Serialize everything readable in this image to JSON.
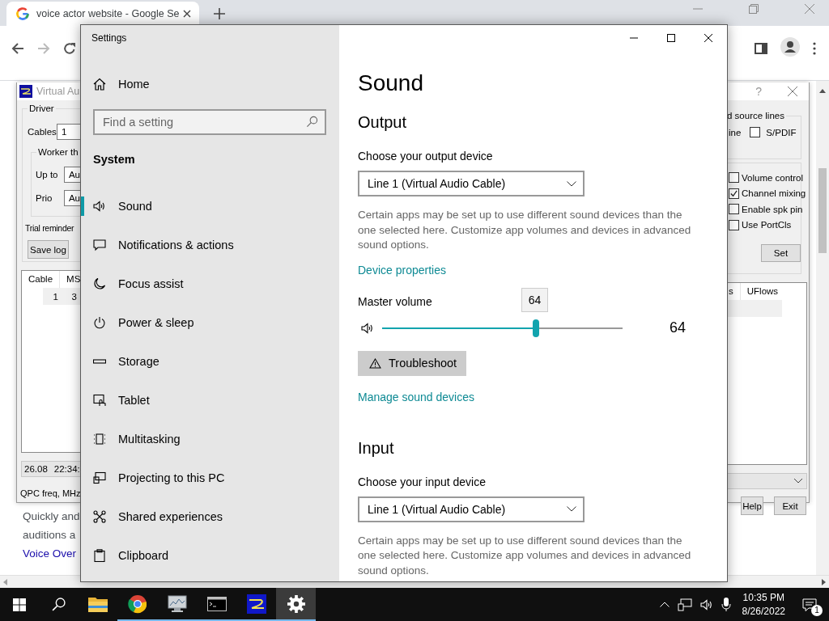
{
  "browser": {
    "tab": {
      "title": "voice actor website - Google Se",
      "selected": true
    },
    "page_lines": [
      {
        "kind": "text",
        "text": "Quickly and"
      },
      {
        "kind": "text",
        "text": "auditions a"
      },
      {
        "kind": "link",
        "text": "Voice Over"
      }
    ]
  },
  "vac": {
    "title": "Virtual Au",
    "driver": {
      "label": "Driver",
      "cables_label": "Cables",
      "cables_value": "1"
    },
    "worker": {
      "label": "Worker th",
      "fields": [
        {
          "label": "Up to",
          "value": "Au"
        },
        {
          "label": "Prio",
          "value": "Au"
        }
      ]
    },
    "trial": "Trial reminder",
    "save_log": "Save log",
    "left_columns": [
      "Cable",
      "MS"
    ],
    "left_row": [
      "1",
      "3"
    ],
    "status": [
      "26.08",
      "22:34:"
    ],
    "qpc": "QPC freq, MHz",
    "help": "?",
    "source_group": "d source lines",
    "source_fragment": "ine",
    "spdif": {
      "label": "S/PDIF",
      "checked": false
    },
    "options": [
      {
        "label": "Volume control",
        "checked": false
      },
      {
        "label": "Channel mixing",
        "checked": true
      },
      {
        "label": "Enable spk pin",
        "checked": false
      },
      {
        "label": "Use PortCls",
        "checked": false
      }
    ],
    "set": "Set",
    "right_columns": [
      "s",
      "UFlows"
    ],
    "buttons": [
      "Help",
      "Exit"
    ]
  },
  "settings": {
    "title": "Settings",
    "home": "Home",
    "search": {
      "placeholder": "Find a setting"
    },
    "section": "System",
    "nav": [
      {
        "kind": "sound",
        "label": "Sound",
        "selected": true
      },
      {
        "kind": "notifications",
        "label": "Notifications & actions",
        "selected": false
      },
      {
        "kind": "focus",
        "label": "Focus assist",
        "selected": false
      },
      {
        "kind": "power",
        "label": "Power & sleep",
        "selected": false
      },
      {
        "kind": "storage",
        "label": "Storage",
        "selected": false
      },
      {
        "kind": "tablet",
        "label": "Tablet",
        "selected": false
      },
      {
        "kind": "multitasking",
        "label": "Multitasking",
        "selected": false
      },
      {
        "kind": "projecting",
        "label": "Projecting to this PC",
        "selected": false
      },
      {
        "kind": "shared",
        "label": "Shared experiences",
        "selected": false
      },
      {
        "kind": "clipboard",
        "label": "Clipboard",
        "selected": false
      }
    ],
    "heading": "Sound",
    "output": {
      "heading": "Output",
      "device_label": "Choose your output device",
      "device": "Line 1 (Virtual Audio Cable)",
      "description": "Certain apps may be set up to use different sound devices than the one selected here. Customize app volumes and devices in advanced sound options.",
      "link": "Device properties"
    },
    "volume": {
      "label": "Master volume",
      "level": 0.64,
      "tooltip": "64",
      "reading": "64"
    },
    "troubleshoot": "Troubleshoot",
    "manage_link": "Manage sound devices",
    "input": {
      "heading": "Input",
      "device_label": "Choose your input device",
      "device": "Line 1 (Virtual Audio Cable)",
      "description": "Certain apps may be set up to use different sound devices than the one selected here. Customize app volumes and devices in advanced sound options."
    }
  },
  "taskbar": {
    "apps": [
      {
        "kind": "explorer",
        "running": false,
        "selected": false
      },
      {
        "kind": "chrome",
        "running": true,
        "selected": false
      },
      {
        "kind": "monitor",
        "running": true,
        "selected": false
      },
      {
        "kind": "terminal",
        "running": true,
        "selected": false
      },
      {
        "kind": "vac",
        "running": true,
        "selected": false
      },
      {
        "kind": "settings",
        "running": true,
        "selected": true
      }
    ],
    "time": "10:35 PM",
    "date": "8/26/2022",
    "notifications": "1"
  }
}
